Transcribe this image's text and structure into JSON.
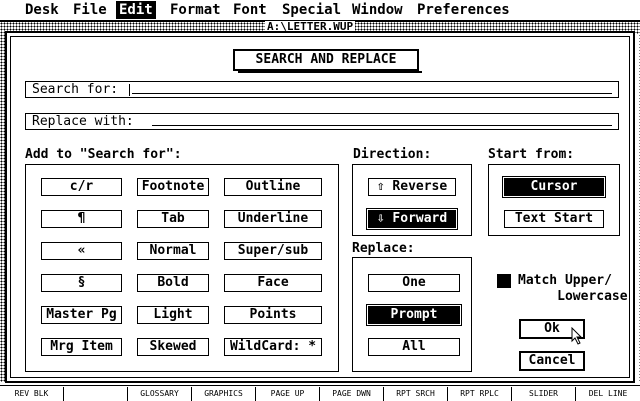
{
  "menubar": [
    "Desk",
    "File",
    "Edit",
    "Format",
    "Font",
    "Special",
    "Window",
    "Preferences"
  ],
  "active_menu": "Edit",
  "window_title": "A:\\LETTER.WUP",
  "dialog": {
    "title": "SEARCH AND REPLACE",
    "search_label": "Search for:",
    "replace_label": "Replace with:",
    "search_value": "",
    "replace_value": "",
    "add_group_label": "Add to \"Search for\":",
    "add_buttons": [
      [
        "c/r",
        "Footnote",
        "Outline"
      ],
      [
        "¶",
        "Tab",
        "Underline"
      ],
      [
        "«",
        "Normal",
        "Super/sub"
      ],
      [
        "§",
        "Bold",
        "Face"
      ],
      [
        "Master Pg",
        "Light",
        "Points"
      ],
      [
        "Mrg Item",
        "Skewed",
        "WildCard: *"
      ]
    ],
    "direction_label": "Direction:",
    "direction_options": [
      "⇧ Reverse",
      "⇩ Forward"
    ],
    "direction_selected": 1,
    "start_label": "Start from:",
    "start_options": [
      "Cursor",
      "Text Start"
    ],
    "start_selected": 0,
    "replace_group_label": "Replace:",
    "replace_options": [
      "One",
      "Prompt",
      "All"
    ],
    "replace_selected": 1,
    "match_case_label": "Match Upper/\n     Lowercase",
    "match_case_checked": true,
    "ok_label": "Ok",
    "cancel_label": "Cancel"
  },
  "function_keys": [
    "REV BLK",
    "",
    "GLOSSARY",
    "GRAPHICS",
    "PAGE UP",
    "PAGE DWN",
    "RPT SRCH",
    "RPT RPLC",
    "SLIDER",
    "DEL LINE"
  ],
  "icons": {
    "pointer": "arrow-pointer-icon"
  }
}
